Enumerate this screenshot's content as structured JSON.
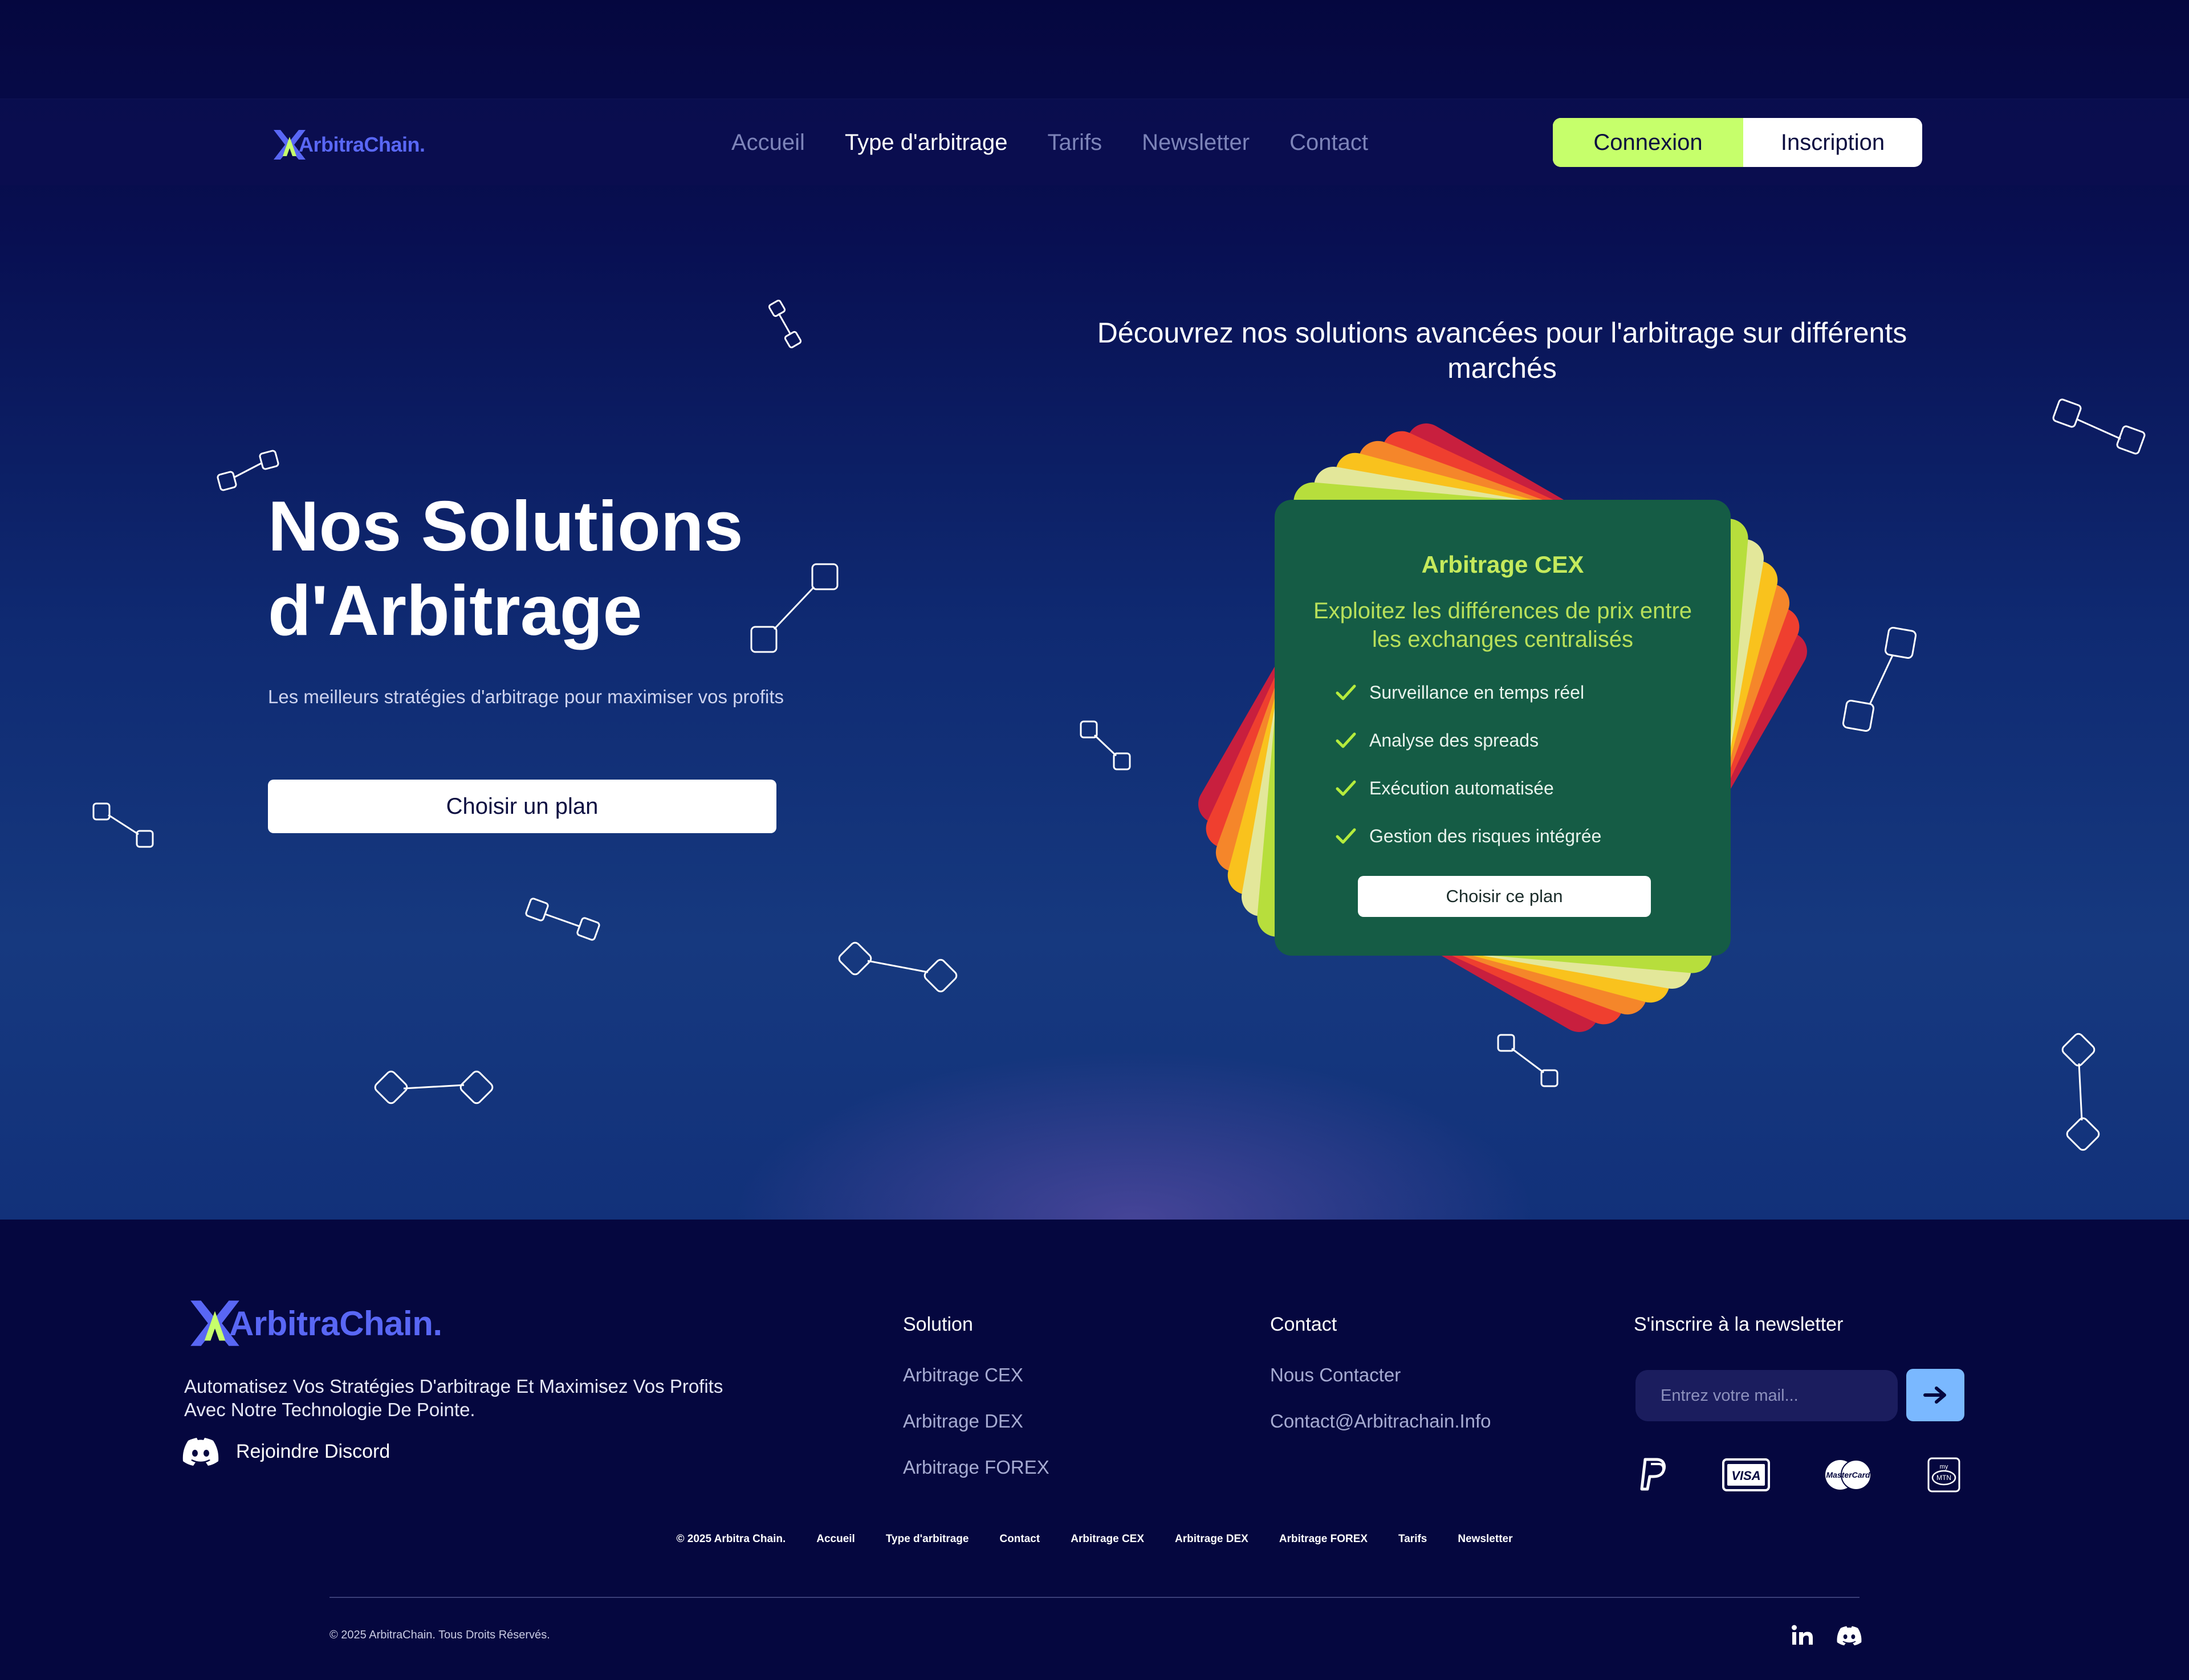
{
  "brand": {
    "name": "ArbitraChain",
    "dot": "."
  },
  "nav": {
    "links": [
      "Accueil",
      "Type d'arbitrage",
      "Tarifs",
      "Newsletter",
      "Contact"
    ],
    "active": 1,
    "login_label": "Connexion",
    "signup_label": "Inscription"
  },
  "hero": {
    "title_line1": "Nos Solutions",
    "title_line2": "d'Arbitrage",
    "subtitle": "Les meilleurs stratégies d'arbitrage pour maximiser vos profits",
    "cta_label": "Choisir un plan",
    "tagline": "Découvrez nos solutions avancées pour l'arbitrage sur différents marchés"
  },
  "plan_card": {
    "title": "Arbitrage CEX",
    "description": "Exploitez les différences de prix entre les exchanges centralisés",
    "features": [
      "Surveillance en temps réel",
      "Analyse des spreads",
      "Exécution automatisée",
      "Gestion des risques intégrée"
    ],
    "button_label": "Choisir ce plan",
    "stack_colors": [
      "#c81f3e",
      "#ef3f2f",
      "#f5862a",
      "#f9c21d",
      "#e3e79a",
      "#b7de3c"
    ]
  },
  "footer": {
    "description": "Automatisez Vos Stratégies D'arbitrage Et Maximisez Vos Profits Avec Notre Technologie De Pointe.",
    "discord_label": "Rejoindre Discord",
    "solution": {
      "heading": "Solution",
      "links": [
        "Arbitrage CEX",
        "Arbitrage DEX",
        "Arbitrage FOREX"
      ]
    },
    "contact": {
      "heading": "Contact",
      "links": [
        "Nous Contacter",
        "Contact@Arbitrachain.Info"
      ]
    },
    "newsletter": {
      "heading": "S'inscrire à la newsletter",
      "placeholder": "Entrez votre mail..."
    },
    "payment_icons": [
      "paypal-icon",
      "visa-icon",
      "mastercard-icon",
      "mtn-momo-icon"
    ],
    "bottom_links": [
      "© 2025 Arbitra Chain.",
      "Accueil",
      "Type d'arbitrage",
      "Contact",
      "Arbitrage CEX",
      "Arbitrage DEX",
      "Arbitrage FOREX",
      "Tarifs",
      "Newsletter"
    ],
    "copyright": "© 2025 ArbitraChain. Tous Droits Réservés.",
    "social_icons": [
      "linkedin-icon",
      "discord-icon"
    ]
  },
  "colors": {
    "background": "#05073f",
    "accent_lime": "#c6ff6b",
    "brand_blue": "#5967f5",
    "card_green": "#155c45",
    "newsletter_button": "#7ab8ff"
  }
}
